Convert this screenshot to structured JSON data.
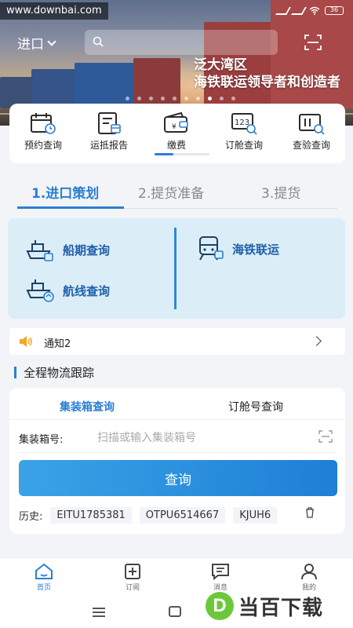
{
  "colors": {
    "accent": "#2b7fd2",
    "panel": "#dbeef8",
    "button": "#1e7fd6",
    "watermark_green": "#6cc83a"
  },
  "status_bar": {
    "watermark": "www.downbai.com",
    "battery": "36"
  },
  "header": {
    "import_select": "进口",
    "search_placeholder": "",
    "slogan_line1": "泛大湾区",
    "slogan_line2": "海铁联运领导者和创造者"
  },
  "quick_menu": [
    {
      "label": "预约查询",
      "icon": "calendar-clock-icon"
    },
    {
      "label": "运抵报告",
      "icon": "report-box-icon"
    },
    {
      "label": "缴费",
      "icon": "wallet-icon"
    },
    {
      "label": "订舱查询",
      "icon": "booking-search-icon"
    },
    {
      "label": "查验查询",
      "icon": "inspection-search-icon"
    }
  ],
  "steps": [
    {
      "label": "1.进口策划",
      "active": true
    },
    {
      "label": "2.提货准备",
      "active": false
    },
    {
      "label": "3.提货",
      "active": false
    }
  ],
  "plan": [
    {
      "label": "船期查询",
      "icon": "ship-schedule-icon"
    },
    {
      "label": "海铁联运",
      "icon": "train-icon"
    },
    {
      "label": "航线查询",
      "icon": "route-ship-icon"
    }
  ],
  "notice": {
    "text": "通知2"
  },
  "tracking": {
    "title": "全程物流跟踪",
    "tabs": [
      {
        "label": "集装箱查询",
        "active": true
      },
      {
        "label": "订舱号查询",
        "active": false
      }
    ],
    "field_label": "集装箱号:",
    "field_placeholder": "扫描或输入集装箱号",
    "query_label": "查询",
    "history_label": "历史:",
    "history": [
      "EITU1785381",
      "OTPU6514667",
      "KJUH6"
    ]
  },
  "bottom_nav": [
    {
      "label": "首页",
      "icon": "home-icon",
      "active": true
    },
    {
      "label": "订阅",
      "icon": "subscribe-icon",
      "active": false
    },
    {
      "label": "消息",
      "icon": "message-icon",
      "active": false
    },
    {
      "label": "我的",
      "icon": "user-icon",
      "active": false
    }
  ],
  "watermark": {
    "logo_letter": "D",
    "text": "当百下载"
  }
}
